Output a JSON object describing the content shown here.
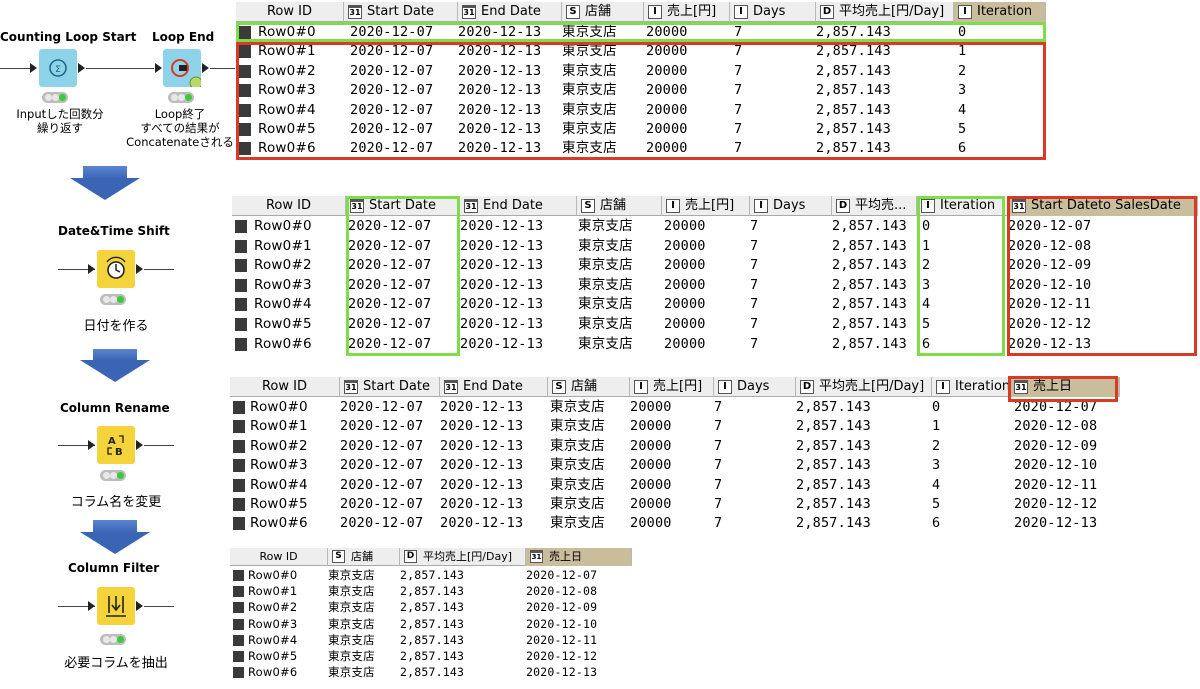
{
  "workflow": {
    "nodes": [
      {
        "title": "Counting Loop Start",
        "caption": "Inputした回数分\n繰り返す",
        "color": "blue",
        "icon": "counter-loop-icon"
      },
      {
        "title": "Loop End",
        "caption": "Loop終了\nすべての結果が\nConcatenateされる",
        "color": "blue",
        "icon": "loop-end-icon"
      },
      {
        "title": "Date&Time Shift",
        "caption": "日付を作る",
        "color": "yellow",
        "icon": "clock-shift-icon"
      },
      {
        "title": "Column Rename",
        "caption": "コラム名を変更",
        "color": "yellow",
        "icon": "rename-icon"
      },
      {
        "title": "Column Filter",
        "caption": "必要コラムを抽出",
        "color": "yellow",
        "icon": "filter-icon"
      }
    ]
  },
  "tables": [
    {
      "id": "loop-end-output",
      "columns": [
        {
          "label": "Row ID",
          "type": ""
        },
        {
          "label": "Start Date",
          "type": "cal"
        },
        {
          "label": "End Date",
          "type": "cal"
        },
        {
          "label": "店舗",
          "type": "S"
        },
        {
          "label": "売上[円]",
          "type": "I"
        },
        {
          "label": "Days",
          "type": "I"
        },
        {
          "label": "平均売上[円/Day]",
          "type": "D"
        },
        {
          "label": "Iteration",
          "type": "I",
          "selected": true
        }
      ],
      "rows": [
        [
          "Row0#0",
          "2020-12-07",
          "2020-12-13",
          "東京支店",
          "20000",
          "7",
          "2,857.143",
          "0"
        ],
        [
          "Row0#1",
          "2020-12-07",
          "2020-12-13",
          "東京支店",
          "20000",
          "7",
          "2,857.143",
          "1"
        ],
        [
          "Row0#2",
          "2020-12-07",
          "2020-12-13",
          "東京支店",
          "20000",
          "7",
          "2,857.143",
          "2"
        ],
        [
          "Row0#3",
          "2020-12-07",
          "2020-12-13",
          "東京支店",
          "20000",
          "7",
          "2,857.143",
          "3"
        ],
        [
          "Row0#4",
          "2020-12-07",
          "2020-12-13",
          "東京支店",
          "20000",
          "7",
          "2,857.143",
          "4"
        ],
        [
          "Row0#5",
          "2020-12-07",
          "2020-12-13",
          "東京支店",
          "20000",
          "7",
          "2,857.143",
          "5"
        ],
        [
          "Row0#6",
          "2020-12-07",
          "2020-12-13",
          "東京支店",
          "20000",
          "7",
          "2,857.143",
          "6"
        ]
      ]
    },
    {
      "id": "date-shift-output",
      "columns": [
        {
          "label": "Row ID",
          "type": ""
        },
        {
          "label": "Start Date",
          "type": "cal"
        },
        {
          "label": "End Date",
          "type": "cal"
        },
        {
          "label": "店舗",
          "type": "S"
        },
        {
          "label": "売上[円]",
          "type": "I"
        },
        {
          "label": "Days",
          "type": "I"
        },
        {
          "label": "平均売...",
          "type": "D"
        },
        {
          "label": "Iteration",
          "type": "I"
        },
        {
          "label": "Start Dateto SalesDate",
          "type": "cal",
          "selected": true
        }
      ],
      "rows": [
        [
          "Row0#0",
          "2020-12-07",
          "2020-12-13",
          "東京支店",
          "20000",
          "7",
          "2,857.143",
          "0",
          "2020-12-07"
        ],
        [
          "Row0#1",
          "2020-12-07",
          "2020-12-13",
          "東京支店",
          "20000",
          "7",
          "2,857.143",
          "1",
          "2020-12-08"
        ],
        [
          "Row0#2",
          "2020-12-07",
          "2020-12-13",
          "東京支店",
          "20000",
          "7",
          "2,857.143",
          "2",
          "2020-12-09"
        ],
        [
          "Row0#3",
          "2020-12-07",
          "2020-12-13",
          "東京支店",
          "20000",
          "7",
          "2,857.143",
          "3",
          "2020-12-10"
        ],
        [
          "Row0#4",
          "2020-12-07",
          "2020-12-13",
          "東京支店",
          "20000",
          "7",
          "2,857.143",
          "4",
          "2020-12-11"
        ],
        [
          "Row0#5",
          "2020-12-07",
          "2020-12-13",
          "東京支店",
          "20000",
          "7",
          "2,857.143",
          "5",
          "2020-12-12"
        ],
        [
          "Row0#6",
          "2020-12-07",
          "2020-12-13",
          "東京支店",
          "20000",
          "7",
          "2,857.143",
          "6",
          "2020-12-13"
        ]
      ]
    },
    {
      "id": "rename-output",
      "columns": [
        {
          "label": "Row ID",
          "type": ""
        },
        {
          "label": "Start Date",
          "type": "cal"
        },
        {
          "label": "End Date",
          "type": "cal"
        },
        {
          "label": "店舗",
          "type": "S"
        },
        {
          "label": "売上[円]",
          "type": "I"
        },
        {
          "label": "Days",
          "type": "I"
        },
        {
          "label": "平均売上[円/Day]",
          "type": "D"
        },
        {
          "label": "Iteration",
          "type": "I"
        },
        {
          "label": "売上日",
          "type": "cal",
          "selected": true
        }
      ],
      "rows": [
        [
          "Row0#0",
          "2020-12-07",
          "2020-12-13",
          "東京支店",
          "20000",
          "7",
          "2,857.143",
          "0",
          "2020-12-07"
        ],
        [
          "Row0#1",
          "2020-12-07",
          "2020-12-13",
          "東京支店",
          "20000",
          "7",
          "2,857.143",
          "1",
          "2020-12-08"
        ],
        [
          "Row0#2",
          "2020-12-07",
          "2020-12-13",
          "東京支店",
          "20000",
          "7",
          "2,857.143",
          "2",
          "2020-12-09"
        ],
        [
          "Row0#3",
          "2020-12-07",
          "2020-12-13",
          "東京支店",
          "20000",
          "7",
          "2,857.143",
          "3",
          "2020-12-10"
        ],
        [
          "Row0#4",
          "2020-12-07",
          "2020-12-13",
          "東京支店",
          "20000",
          "7",
          "2,857.143",
          "4",
          "2020-12-11"
        ],
        [
          "Row0#5",
          "2020-12-07",
          "2020-12-13",
          "東京支店",
          "20000",
          "7",
          "2,857.143",
          "5",
          "2020-12-12"
        ],
        [
          "Row0#6",
          "2020-12-07",
          "2020-12-13",
          "東京支店",
          "20000",
          "7",
          "2,857.143",
          "6",
          "2020-12-13"
        ]
      ]
    },
    {
      "id": "filter-output",
      "columns": [
        {
          "label": "Row ID",
          "type": ""
        },
        {
          "label": "店舗",
          "type": "S"
        },
        {
          "label": "平均売上[円/Day]",
          "type": "D"
        },
        {
          "label": "売上日",
          "type": "cal",
          "selected": true
        }
      ],
      "rows": [
        [
          "Row0#0",
          "東京支店",
          "2,857.143",
          "2020-12-07"
        ],
        [
          "Row0#1",
          "東京支店",
          "2,857.143",
          "2020-12-08"
        ],
        [
          "Row0#2",
          "東京支店",
          "2,857.143",
          "2020-12-09"
        ],
        [
          "Row0#3",
          "東京支店",
          "2,857.143",
          "2020-12-10"
        ],
        [
          "Row0#4",
          "東京支店",
          "2,857.143",
          "2020-12-11"
        ],
        [
          "Row0#5",
          "東京支店",
          "2,857.143",
          "2020-12-12"
        ],
        [
          "Row0#6",
          "東京支店",
          "2,857.143",
          "2020-12-13"
        ]
      ]
    }
  ],
  "colors": {
    "highlight_green": "#7fdc4a",
    "highlight_red": "#d93a25",
    "node_blue": "#8fd3e8",
    "node_yellow": "#f5d43b",
    "arrow_blue": "#3a64b4"
  }
}
